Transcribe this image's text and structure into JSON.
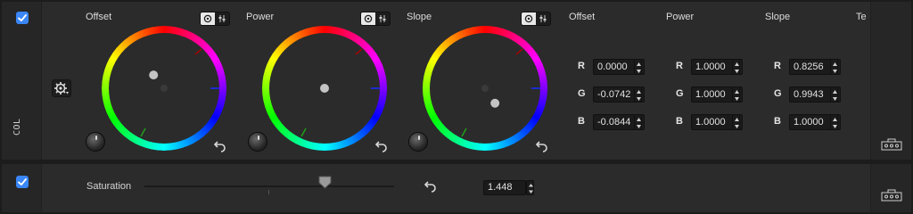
{
  "col_panel": {
    "side_label": "COL",
    "enabled": true,
    "wheels": [
      {
        "title": "Offset",
        "puck": {
          "dx": -0.19,
          "dy": -0.24
        },
        "reset_icon": "undo-icon"
      },
      {
        "title": "Power",
        "puck": {
          "dx": 0.0,
          "dy": 0.0
        },
        "reset_icon": "undo-icon"
      },
      {
        "title": "Slope",
        "puck": {
          "dx": 0.18,
          "dy": 0.27
        },
        "reset_icon": "undo-icon"
      }
    ],
    "columns": [
      {
        "title": "Offset",
        "rows": [
          {
            "channel": "R",
            "value": "0.0000"
          },
          {
            "channel": "G",
            "value": "-0.0742"
          },
          {
            "channel": "B",
            "value": "-0.0844"
          }
        ]
      },
      {
        "title": "Power",
        "rows": [
          {
            "channel": "R",
            "value": "1.0000"
          },
          {
            "channel": "G",
            "value": "1.0000"
          },
          {
            "channel": "B",
            "value": "1.0000"
          }
        ]
      },
      {
        "title": "Slope",
        "rows": [
          {
            "channel": "R",
            "value": "0.8256"
          },
          {
            "channel": "G",
            "value": "0.9943"
          },
          {
            "channel": "B",
            "value": "1.0000"
          }
        ]
      }
    ],
    "cut_column_title": "Te"
  },
  "sat_panel": {
    "enabled": true,
    "label": "Saturation",
    "value": "1.448",
    "slider_fraction": 0.72
  },
  "colors": {
    "accent": "#3a86f7"
  }
}
